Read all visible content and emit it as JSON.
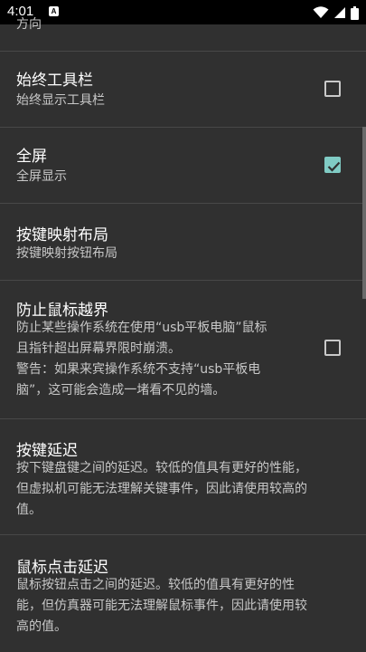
{
  "status_bar": {
    "time": "4:01",
    "notification_letter": "A"
  },
  "prefs": [
    {
      "title": "",
      "summary": "方向"
    },
    {
      "title": "始终工具栏",
      "summary": "始终显示工具栏",
      "checked": false
    },
    {
      "title": "全屏",
      "summary": "全屏显示",
      "checked": true
    },
    {
      "title": "按键映射布局",
      "summary": "按键映射按钮布局"
    },
    {
      "title": "防止鼠标越界",
      "summary_lines": [
        "防止某些操作系统在使用“usb平板电脑”鼠标",
        "且指针超出屏幕界限时崩溃。",
        "警告：如果来宾操作系统不支持“usb平板电",
        "脑”，这可能会造成一堵看不见的墙。"
      ],
      "checked": false
    },
    {
      "title": "按键延迟",
      "summary_lines": [
        "按下键盘键之间的延迟。较低的值具有更好的性能，",
        "但虚拟机可能无法理解关键事件，因此请使用较高的",
        "值。"
      ]
    },
    {
      "title": "鼠标点击延迟",
      "summary_lines": [
        "鼠标按钮点击之间的延迟。较低的值具有更好的性",
        "能，但仿真器可能无法理解鼠标事件，因此请使用较",
        "高的值。"
      ]
    }
  ],
  "colors": {
    "background": "#303030",
    "accent": "#80cbc4",
    "divider": "#484848"
  }
}
